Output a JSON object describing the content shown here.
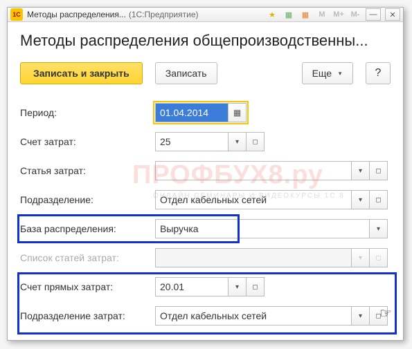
{
  "titlebar": {
    "app_icon": "1С",
    "title": "Методы распределения...",
    "subtitle": "(1С:Предприятие)"
  },
  "heading": "Методы распределения общепроизводственны...",
  "toolbar": {
    "save_close": "Записать и закрыть",
    "save": "Записать",
    "more": "Еще",
    "help": "?"
  },
  "fields": {
    "period": {
      "label": "Период:",
      "value": "01.04.2014"
    },
    "cost_account": {
      "label": "Счет затрат:",
      "value": "25"
    },
    "cost_item": {
      "label": "Статья затрат:",
      "value": ""
    },
    "department": {
      "label": "Подразделение:",
      "value": "Отдел кабельных сетей"
    },
    "distribution_base": {
      "label": "База распределения:",
      "value": "Выручка"
    },
    "cost_items_list": {
      "label": "Список статей затрат:",
      "value": ""
    },
    "direct_cost_account": {
      "label": "Счет прямых затрат:",
      "value": "20.01"
    },
    "cost_department": {
      "label": "Подразделение затрат:",
      "value": "Отдел кабельных сетей"
    }
  },
  "watermark": "ПРОФБУХ8.ру",
  "watermark_sub": "ОНЛАЙН СЕМИНАРЫ И ВИДЕОКУРСЫ 1С 8"
}
